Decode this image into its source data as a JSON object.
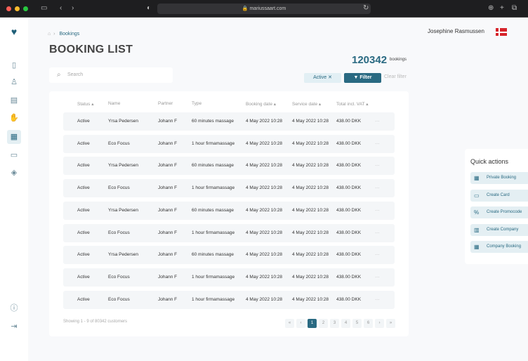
{
  "browser": {
    "url": "mariussaart.com"
  },
  "breadcrumb": {
    "current": "Bookings"
  },
  "page_title": "BOOKING LIST",
  "search": {
    "placeholder": "Search"
  },
  "user": {
    "name": "Josephine Rasmussen"
  },
  "stats": {
    "count": "120342",
    "label": "bookings"
  },
  "filters": {
    "active_chip": "Active ✕",
    "filter_label": "Filter",
    "clear_label": "Clear filter"
  },
  "table": {
    "headers": [
      "Status ▴",
      "Name",
      "Partner",
      "Type",
      "Booking date ▴",
      "Service date ▴",
      "Total incl. VAT ▴"
    ],
    "rows": [
      [
        "Active",
        "Yrsa Pedersen",
        "Johann F",
        "60 minutes massage",
        "4 May 2022 10:28",
        "4 May 2022 10:28",
        "438.00 DKK"
      ],
      [
        "Active",
        "Eco Focus",
        "Johann F",
        "1 hour firmamassage",
        "4 May 2022 10:28",
        "4 May 2022 10:28",
        "438.00 DKK"
      ],
      [
        "Active",
        "Yrsa Pedersen",
        "Johann F",
        "60 minutes massage",
        "4 May 2022 10:28",
        "4 May 2022 10:28",
        "438.00 DKK"
      ],
      [
        "Active",
        "Eco Focus",
        "Johann F",
        "1 hour firmamassage",
        "4 May 2022 10:28",
        "4 May 2022 10:28",
        "438.00 DKK"
      ],
      [
        "Active",
        "Yrsa Pedersen",
        "Johann F",
        "60 minutes massage",
        "4 May 2022 10:28",
        "4 May 2022 10:28",
        "438.00 DKK"
      ],
      [
        "Active",
        "Eco Focus",
        "Johann F",
        "1 hour firmamassage",
        "4 May 2022 10:28",
        "4 May 2022 10:28",
        "438.00 DKK"
      ],
      [
        "Active",
        "Yrsa Pedersen",
        "Johann F",
        "60 minutes massage",
        "4 May 2022 10:28",
        "4 May 2022 10:28",
        "438.00 DKK"
      ],
      [
        "Active",
        "Eco Focus",
        "Johann F",
        "1 hour firmamassage",
        "4 May 2022 10:28",
        "4 May 2022 10:28",
        "438.00 DKK"
      ],
      [
        "Active",
        "Eco Focus",
        "Johann F",
        "1 hour firmamassage",
        "4 May 2022 10:28",
        "4 May 2022 10:28",
        "438.00 DKK"
      ]
    ],
    "more": "···"
  },
  "pagination": {
    "showing": "Showing 1 - 9 of 80342 customers",
    "pages": [
      "«",
      "‹",
      "1",
      "2",
      "3",
      "4",
      "5",
      "6",
      "›",
      "»"
    ],
    "current": "1"
  },
  "quick_actions": {
    "title": "Quick actions",
    "items": [
      "Private Booking",
      "Create Card",
      "Create Promocode",
      "Create Company",
      "Company Booking"
    ]
  }
}
